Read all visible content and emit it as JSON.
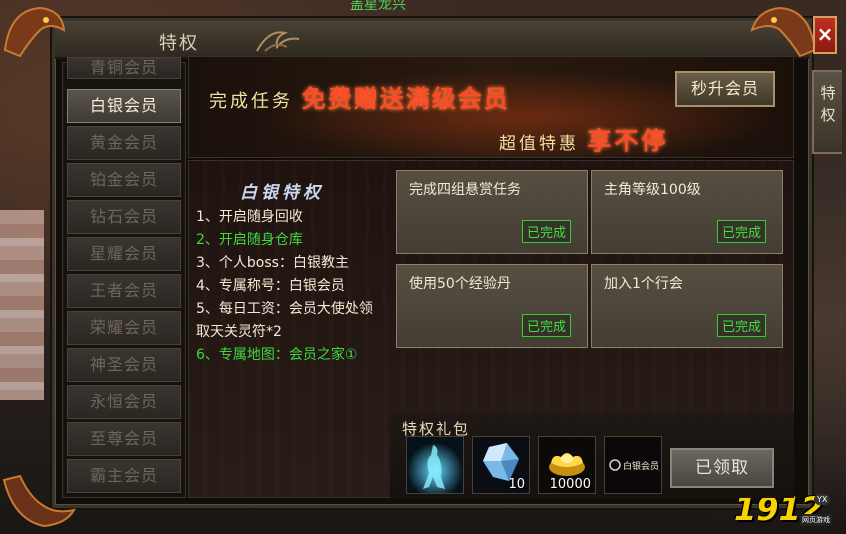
{
  "scene": {
    "top_text": "盖星龙兴"
  },
  "window": {
    "title": "特权",
    "close_label": "×",
    "side_tab_label": "特权"
  },
  "sidebar": {
    "items": [
      {
        "label": "青铜会员",
        "active": false
      },
      {
        "label": "白银会员",
        "active": true
      },
      {
        "label": "黄金会员",
        "active": false
      },
      {
        "label": "铂金会员",
        "active": false
      },
      {
        "label": "钻石会员",
        "active": false
      },
      {
        "label": "星耀会员",
        "active": false
      },
      {
        "label": "王者会员",
        "active": false
      },
      {
        "label": "荣耀会员",
        "active": false
      },
      {
        "label": "神圣会员",
        "active": false
      },
      {
        "label": "永恒会员",
        "active": false
      },
      {
        "label": "至尊会员",
        "active": false
      },
      {
        "label": "霸主会员",
        "active": false
      }
    ]
  },
  "banner": {
    "line1_prefix": "完成任务",
    "line1_em": "免费赠送满级会员",
    "line2_prefix": "超值特惠",
    "line2_em": "享不停",
    "rise_button": "秒升会员"
  },
  "privileges": {
    "title": "白银特权",
    "items": [
      {
        "text": "1、开启随身回收",
        "highlight": false
      },
      {
        "text": "2、开启随身仓库",
        "highlight": true
      },
      {
        "text": "3、个人boss：白银教主",
        "highlight": false
      },
      {
        "text": "4、专属称号：白银会员",
        "highlight": false
      },
      {
        "text": "5、每日工资：会员大使处领取天关灵符*2",
        "highlight": false
      },
      {
        "text": "6、专属地图：会员之家①",
        "highlight": true
      }
    ]
  },
  "tasks": [
    {
      "name": "完成四组悬赏任务",
      "status": "已完成"
    },
    {
      "name": "主角等级100级",
      "status": "已完成"
    },
    {
      "name": "使用50个经验丹",
      "status": "已完成"
    },
    {
      "name": "加入1个行会",
      "status": "已完成"
    }
  ],
  "gifts": {
    "title": "特权礼包",
    "items": [
      {
        "icon": "spirit-figure-icon",
        "count": ""
      },
      {
        "icon": "crystal-icon",
        "count": "10"
      },
      {
        "icon": "gold-ingot-icon",
        "count": "10000"
      },
      {
        "icon": "title-badge-icon",
        "count": "",
        "badge_text": "白银会员"
      }
    ],
    "claim_button": "已领取"
  },
  "logo": {
    "number": "1912",
    "yx": "YX",
    "sub": "网页游戏"
  },
  "colors": {
    "highlight_green": "#3fd83f",
    "banner_red": "#ff4a28",
    "close_red": "#c23020"
  }
}
